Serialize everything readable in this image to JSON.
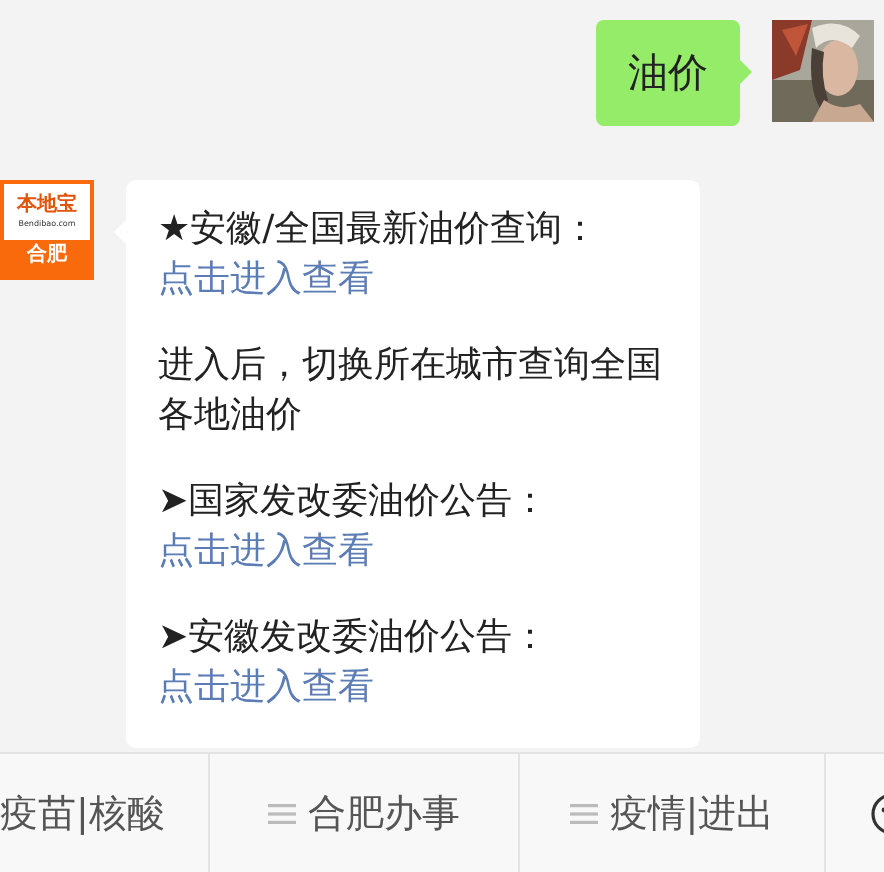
{
  "sent": {
    "text": "油价"
  },
  "received": {
    "logo": {
      "brand": "本地宝",
      "domain": "Bendibao.com",
      "city": "合肥"
    },
    "paragraphs": [
      [
        {
          "kind": "plain",
          "text": "★安徽/全国最新油价查询："
        },
        {
          "kind": "link",
          "text": "点击进入查看"
        }
      ],
      [
        {
          "kind": "plain",
          "text": "进入后，切换所在城市查询全国各地油价"
        }
      ],
      [
        {
          "kind": "plain",
          "text": "➤国家发改委油价公告："
        },
        {
          "kind": "link",
          "text": "点击进入查看"
        }
      ],
      [
        {
          "kind": "plain",
          "text": "➤安徽发改委油价公告："
        },
        {
          "kind": "link",
          "text": "点击进入查看"
        }
      ]
    ]
  },
  "menu_bar": [
    {
      "kind": "menu",
      "label": "疫苗|核酸",
      "menu_icon": false
    },
    {
      "kind": "menu",
      "label": "合肥办事",
      "menu_icon": true
    },
    {
      "kind": "menu",
      "label": "疫情|进出",
      "menu_icon": true
    },
    {
      "kind": "switch"
    }
  ]
}
